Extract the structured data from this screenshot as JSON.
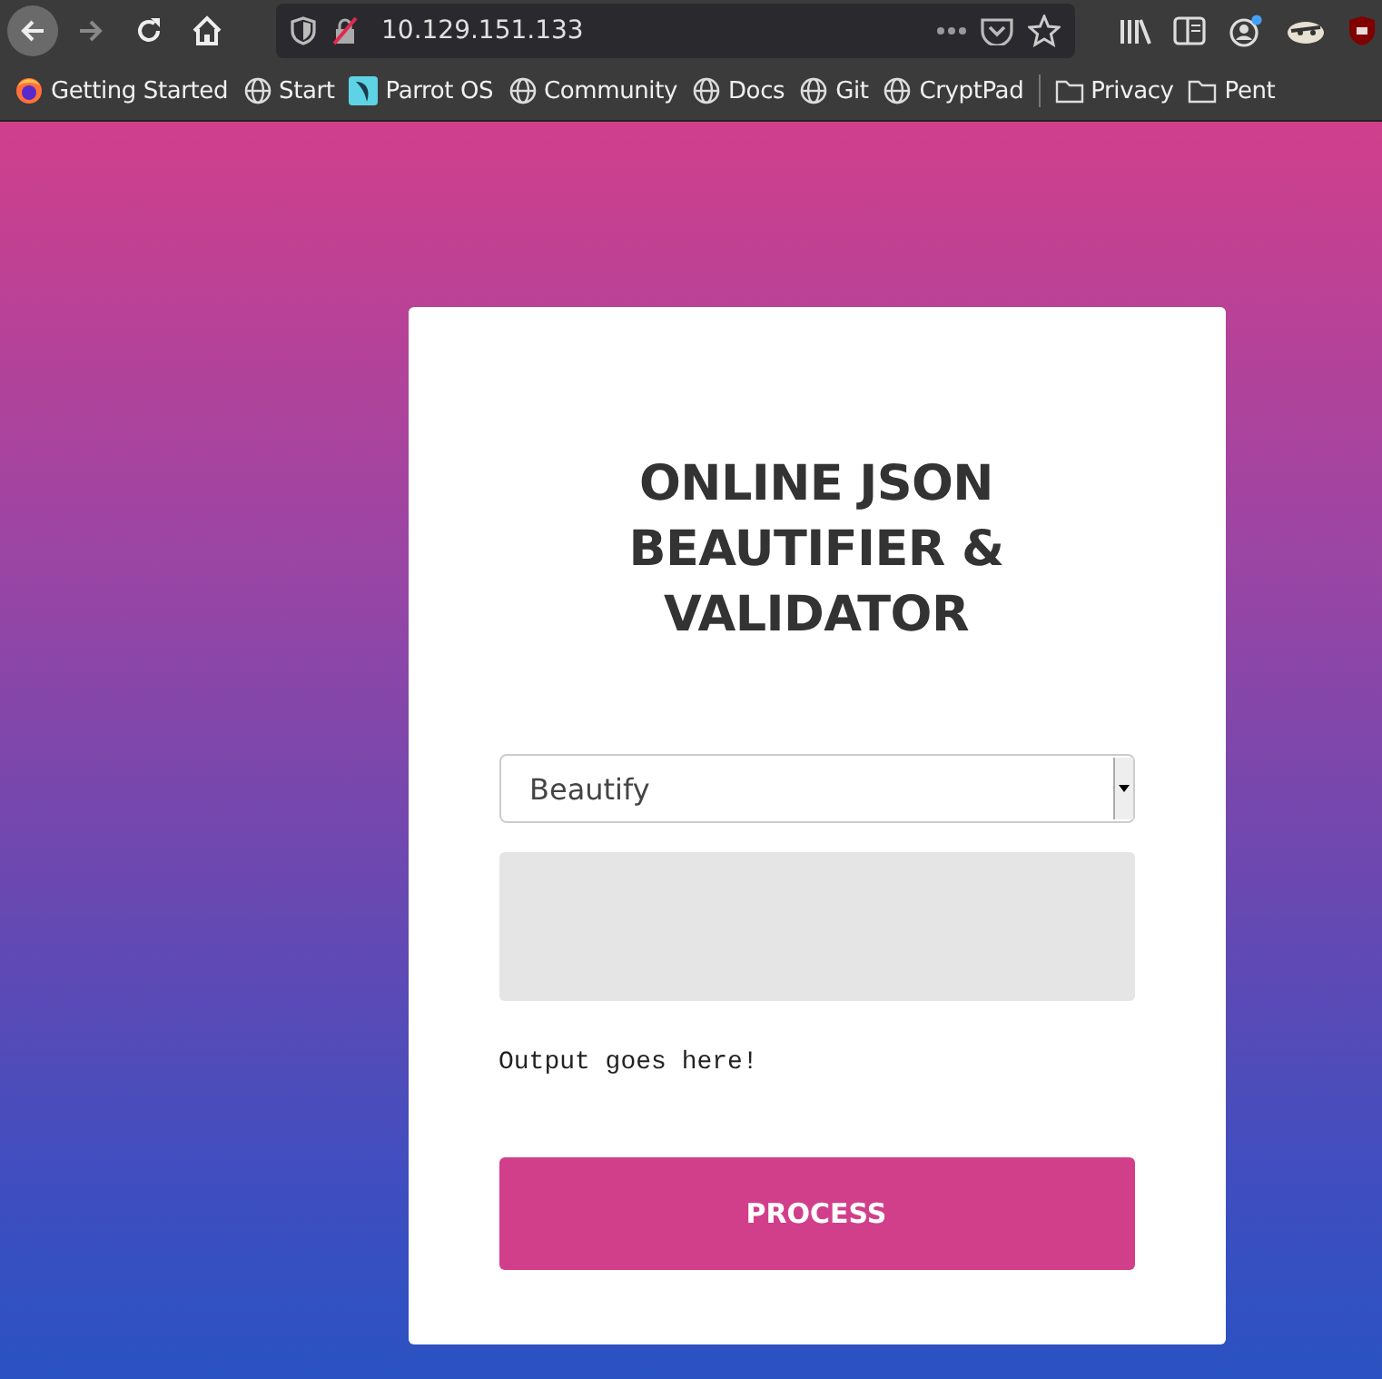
{
  "browser": {
    "nav_buttons": [
      {
        "kind": "back",
        "disabled": false
      },
      {
        "kind": "forward",
        "disabled": true
      },
      {
        "kind": "reload",
        "disabled": false
      },
      {
        "kind": "home",
        "disabled": false
      }
    ],
    "address_bar": {
      "url": "10.129.151.133"
    },
    "bookmarks": [
      {
        "kind": "firefox",
        "label": "Getting Started"
      },
      {
        "kind": "globe",
        "label": "Start"
      },
      {
        "kind": "parrot",
        "label": "Parrot OS"
      },
      {
        "kind": "globe",
        "label": "Community"
      },
      {
        "kind": "globe",
        "label": "Docs"
      },
      {
        "kind": "globe",
        "label": "Git"
      },
      {
        "kind": "globe",
        "label": "CryptPad"
      },
      {
        "kind": "folder",
        "label": "Privacy"
      },
      {
        "kind": "folder",
        "label": "Pent"
      }
    ]
  },
  "page": {
    "title": "ONLINE JSON BEAUTIFIER & VALIDATOR",
    "mode_select": {
      "value": "Beautify"
    },
    "output": "Output goes here!",
    "process_button": "PROCESS"
  }
}
